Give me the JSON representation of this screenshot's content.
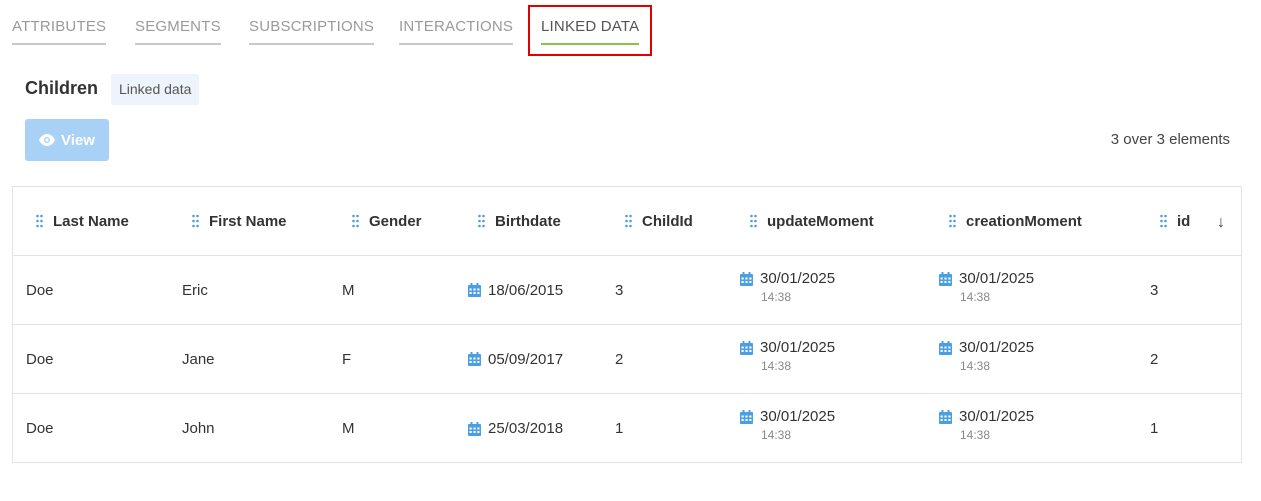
{
  "tabs": [
    {
      "label": "ATTRIBUTES",
      "active": false
    },
    {
      "label": "SEGMENTS",
      "active": false
    },
    {
      "label": "SUBSCRIPTIONS",
      "active": false
    },
    {
      "label": "INTERACTIONS",
      "active": false
    },
    {
      "label": "LINKED DATA",
      "active": true
    }
  ],
  "section": {
    "title": "Children",
    "badge": "Linked data",
    "view_label": "View",
    "count": "3 over 3 elements"
  },
  "colors": {
    "accent_green": "#8bc34a",
    "view_button": "#a9d1f5",
    "icon_blue": "#4a9fe0",
    "highlight_red": "#e00000"
  },
  "table": {
    "columns": [
      "Last Name",
      "First Name",
      "Gender",
      "Birthdate",
      "ChildId",
      "updateMoment",
      "creationMoment",
      "id"
    ],
    "sort_icon": "arrow-down-icon",
    "rows": [
      {
        "last_name": "Doe",
        "first_name": "Eric",
        "gender": "M",
        "birthdate": "18/06/2015",
        "child_id": "3",
        "update_date": "30/01/2025",
        "update_time": "14:38",
        "creation_date": "30/01/2025",
        "creation_time": "14:38",
        "id": "3"
      },
      {
        "last_name": "Doe",
        "first_name": "Jane",
        "gender": "F",
        "birthdate": "05/09/2017",
        "child_id": "2",
        "update_date": "30/01/2025",
        "update_time": "14:38",
        "creation_date": "30/01/2025",
        "creation_time": "14:38",
        "id": "2"
      },
      {
        "last_name": "Doe",
        "first_name": "John",
        "gender": "M",
        "birthdate": "25/03/2018",
        "child_id": "1",
        "update_date": "30/01/2025",
        "update_time": "14:38",
        "creation_date": "30/01/2025",
        "creation_time": "14:38",
        "id": "1"
      }
    ]
  }
}
